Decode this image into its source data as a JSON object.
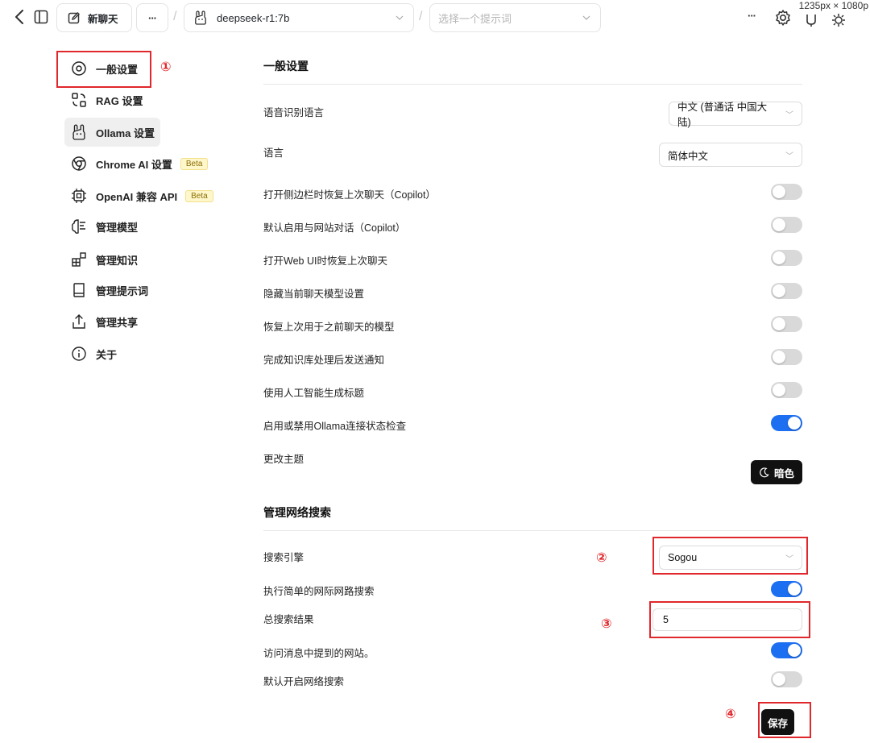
{
  "screen_dims_overlay": "1235px × 1080p",
  "topbar": {
    "new_chat_label": "新聊天",
    "more_glyph": "···",
    "model_name": "deepseek-r1:7b",
    "prompt_placeholder": "选择一个提示词",
    "right_more": "···",
    "icons": [
      "back-chevron-icon",
      "sidebar-toggle-icon",
      "new-chat-pencil-icon",
      "ollama-icon",
      "settings-gear-icon",
      "branch-icon",
      "sparkle-icon"
    ]
  },
  "sidebar": {
    "items": [
      {
        "label": "一般设置",
        "icon": "gear-icon",
        "active": false
      },
      {
        "label": "RAG 设置",
        "icon": "rag-icon",
        "active": false
      },
      {
        "label": "Ollama 设置",
        "icon": "ollama-icon",
        "active": true
      },
      {
        "label": "Chrome AI 设置",
        "icon": "chrome-icon",
        "badge": "Beta"
      },
      {
        "label": "OpenAI 兼容 API",
        "icon": "chip-icon",
        "badge": "Beta"
      },
      {
        "label": "管理模型",
        "icon": "brain-icon"
      },
      {
        "label": "管理知识",
        "icon": "blocks-icon"
      },
      {
        "label": "管理提示词",
        "icon": "book-icon"
      },
      {
        "label": "管理共享",
        "icon": "share-icon"
      },
      {
        "label": "关于",
        "icon": "info-icon"
      }
    ]
  },
  "general": {
    "title": "一般设置",
    "speech_lang_label": "语音识别语言",
    "speech_lang_value": "中文 (普通话 中国大陆)",
    "language_label": "语言",
    "language_value": "简体中文",
    "toggles": [
      {
        "label": "打开侧边栏时恢复上次聊天（Copilot）",
        "on": false
      },
      {
        "label": "默认启用与网站对话（Copilot）",
        "on": false
      },
      {
        "label": "打开Web UI时恢复上次聊天",
        "on": false
      },
      {
        "label": "隐藏当前聊天模型设置",
        "on": false
      },
      {
        "label": "恢复上次用于之前聊天的模型",
        "on": false
      },
      {
        "label": "完成知识库处理后发送通知",
        "on": false
      },
      {
        "label": "使用人工智能生成标题",
        "on": false
      },
      {
        "label": "启用或禁用Ollama连接状态检查",
        "on": true
      }
    ],
    "theme_label": "更改主题",
    "theme_button": "暗色"
  },
  "web_search": {
    "title": "管理网络搜索",
    "engine_label": "搜索引擎",
    "engine_value": "Sogou",
    "simple_search_label": "执行简单的网际网路搜索",
    "simple_search_on": true,
    "total_results_label": "总搜索结果",
    "total_results_value": "5",
    "visit_sites_label": "访问消息中提到的网站。",
    "visit_sites_on": true,
    "default_search_label": "默认开启网络搜索",
    "default_search_on": false,
    "save_button": "保存"
  },
  "annotations": {
    "marker_1": "①",
    "marker_2": "②",
    "marker_3": "③",
    "marker_4": "④",
    "color": "#e0272b"
  },
  "colors": {
    "toggle_on": "#1d6ff2",
    "toggle_off": "#d9d9d9",
    "button_dark": "#111111",
    "annotation": "#e0272b"
  }
}
